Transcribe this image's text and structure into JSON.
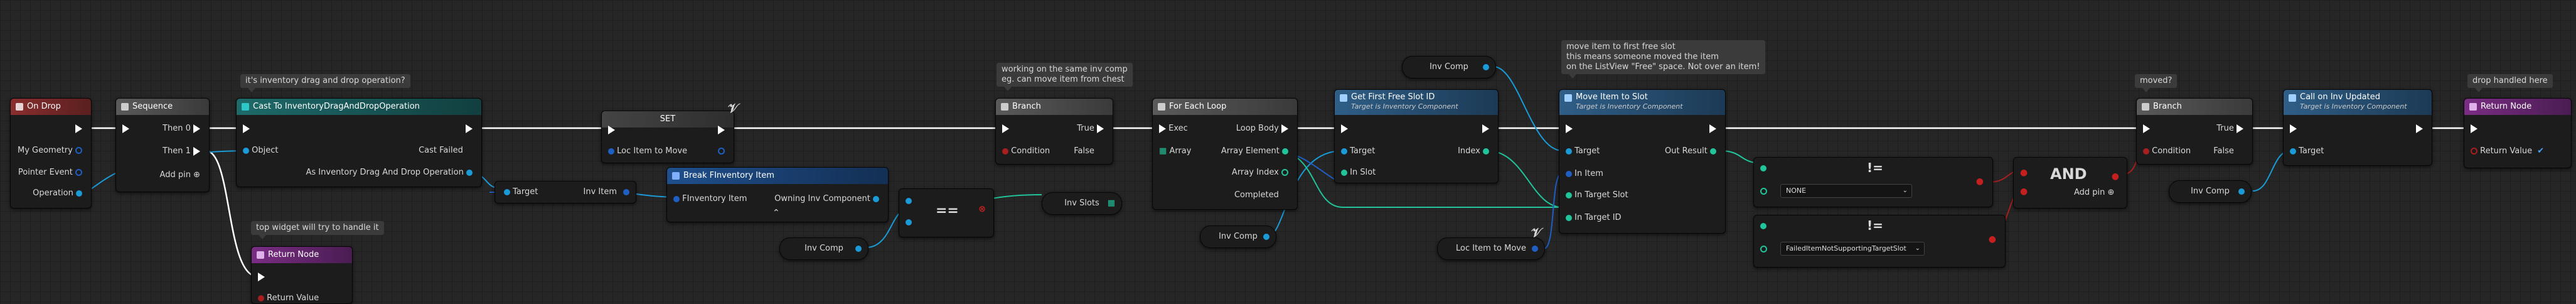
{
  "colors": {
    "event_header": "#7b2d2d",
    "function_header": "#355c7d",
    "flow_header": "#4a4a4a",
    "macro_header": "#555555",
    "return_header": "#6b2d74",
    "object_pin": "#1a9bd7",
    "struct_pin": "#1f5fc4",
    "bool_pin": "#a81f1f",
    "int_pin": "#21c49b",
    "exec_wire": "#ffffff"
  },
  "comments": {
    "drag_drop_op": "it's inventory drag and drop operation?",
    "top_widget": "top widget will try to handle it",
    "same_inv": [
      "working on the same inv comp",
      "eg. can move item from chest"
    ],
    "move_free": [
      "move item to first free slot",
      "this means someone moved the item",
      "on the ListView \"Free\" space. Not over an item!"
    ],
    "moved": "moved?",
    "drop_handled": "drop handled here"
  },
  "on_drop": {
    "title": "On Drop",
    "pins": [
      "My Geometry",
      "Pointer Event",
      "Operation"
    ]
  },
  "sequence": {
    "title": "Sequence",
    "then0": "Then 0",
    "then1": "Then 1",
    "add_pin": "Add pin"
  },
  "cast": {
    "title": "Cast To InventoryDragAndDropOperation",
    "object": "Object",
    "cast_failed": "Cast Failed",
    "as_op": "As Inventory Drag And Drop Operation"
  },
  "return_left": {
    "title": "Return Node",
    "return_value": "Return Value"
  },
  "set_node": {
    "title": "SET",
    "pin": "Loc Item to Move"
  },
  "break_item": {
    "title": "Break FInventory Item",
    "in_pin": "FInventory Item",
    "out_pin": "Owning Inv Component"
  },
  "target_inv_item": {
    "target": "Target",
    "inv_item": "Inv Item"
  },
  "equal": {
    "label": "=="
  },
  "inv_comp_a": "Inv Comp",
  "branch1": {
    "title": "Branch",
    "condition": "Condition",
    "true_label": "True",
    "false_label": "False"
  },
  "for_each": {
    "title": "For Each Loop",
    "exec": "Exec",
    "array": "Array",
    "loop_body": "Loop Body",
    "array_element": "Array Element",
    "array_index": "Array Index",
    "completed": "Completed"
  },
  "inv_slots": "Inv Slots",
  "get_first_free": {
    "title": "Get First Free Slot ID",
    "subtitle": "Target is Inventory Component",
    "target": "Target",
    "in_slot": "In Slot",
    "index": "Index"
  },
  "inv_comp_b": "Inv Comp",
  "inv_comp_c": "Inv Comp",
  "loc_item_get": "Loc Item to Move",
  "move_item": {
    "title": "Move Item to Slot",
    "subtitle": "Target is Inventory Component",
    "target": "Target",
    "in_item": "In Item",
    "in_target_slot": "In Target Slot",
    "in_target_id": "In Target ID",
    "out_result": "Out Result"
  },
  "neq1": {
    "label": "!=",
    "option": "NONE"
  },
  "neq2": {
    "label": "!=",
    "option": "FailedItemNotSupportingTargetSlot"
  },
  "and_node": {
    "label": "AND",
    "add_pin": "Add pin"
  },
  "branch2": {
    "title": "Branch",
    "condition": "Condition",
    "true_label": "True",
    "false_label": "False"
  },
  "inv_comp_d": "Inv Comp",
  "call_updated": {
    "title": "Call on Inv Updated",
    "subtitle": "Target is Inventory Component",
    "target": "Target"
  },
  "return_right": {
    "title": "Return Node",
    "return_value": "Return Value"
  }
}
